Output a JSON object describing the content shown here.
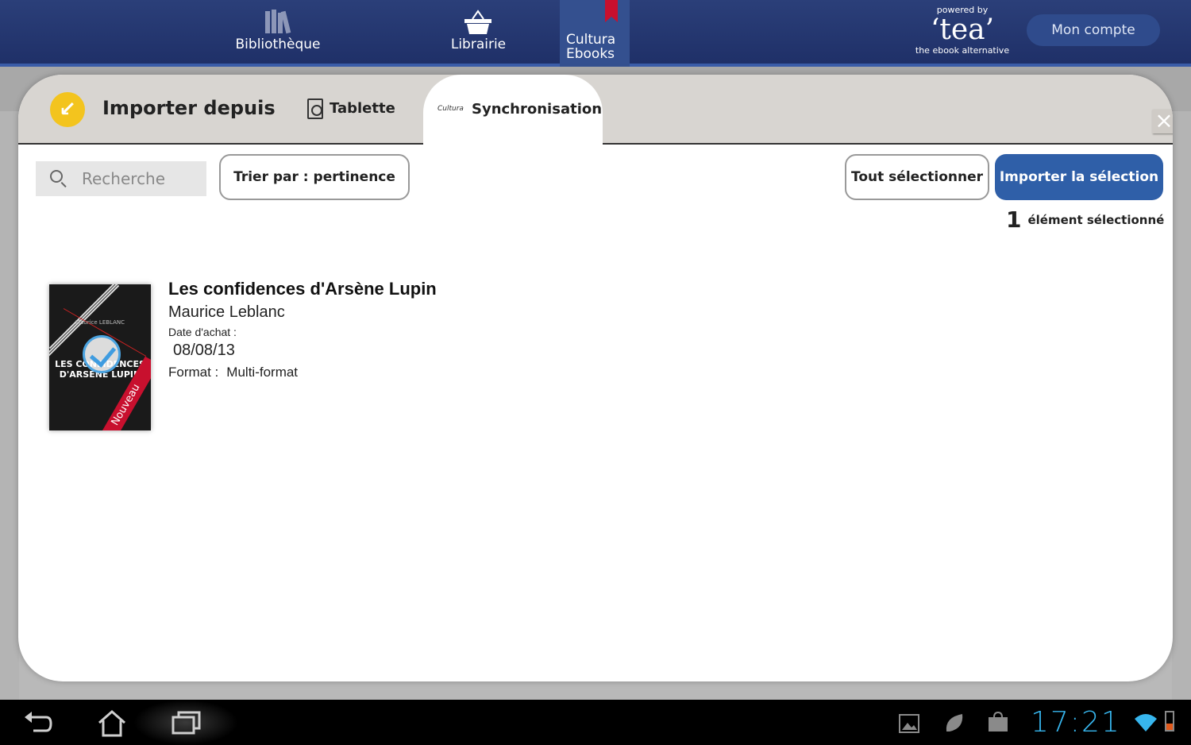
{
  "topbar": {
    "nav": [
      {
        "label": "Bibliothèque",
        "icon": "books-icon"
      },
      {
        "label": "Librairie",
        "icon": "basket-icon"
      },
      {
        "label_line1": "Cultura",
        "label_line2": "Ebooks",
        "icon": "bookmark-icon"
      }
    ],
    "powered_by": "powered by",
    "brand": "‘tea’",
    "tagline": "the ebook alternative",
    "account_button": "Mon compte"
  },
  "modal": {
    "title": "Importer depuis",
    "tabs": [
      {
        "label": "Tablette",
        "icon": "tablet-icon",
        "active": false
      },
      {
        "label": "Synchronisation",
        "icon_text": "Cultura",
        "active": true
      }
    ],
    "close_icon": "×",
    "search": {
      "placeholder": "Recherche",
      "value": ""
    },
    "sort_button": "Trier par : pertinence",
    "select_all_button": "Tout sélectionner",
    "import_button": "Importer la sélection",
    "selection": {
      "count": "1",
      "label": "élément sélectionné"
    },
    "books": [
      {
        "title": "Les confidences d'Arsène Lupin",
        "author": "Maurice Leblanc",
        "date_label": "Date d'achat :",
        "date": "08/08/13",
        "format_label": "Format :",
        "format": "Multi-format",
        "cover_title": "LES CONFIDENCES D'ARSÈNE LUPIN",
        "cover_author": "Maurice LEBLANC",
        "badge": "Nouveau",
        "selected": true
      }
    ]
  },
  "system_bar": {
    "clock": "17:21",
    "icons": [
      "back-icon",
      "home-icon",
      "recent-apps-icon",
      "gallery-icon",
      "leaf-icon",
      "store-icon",
      "wifi-icon",
      "battery-icon"
    ]
  },
  "colors": {
    "topbar": "#22356e",
    "accent_blue": "#2f5fa8",
    "clock_blue": "#37b6ee",
    "badge_red": "#c8102e",
    "import_icon_yellow": "#f3c41e"
  }
}
